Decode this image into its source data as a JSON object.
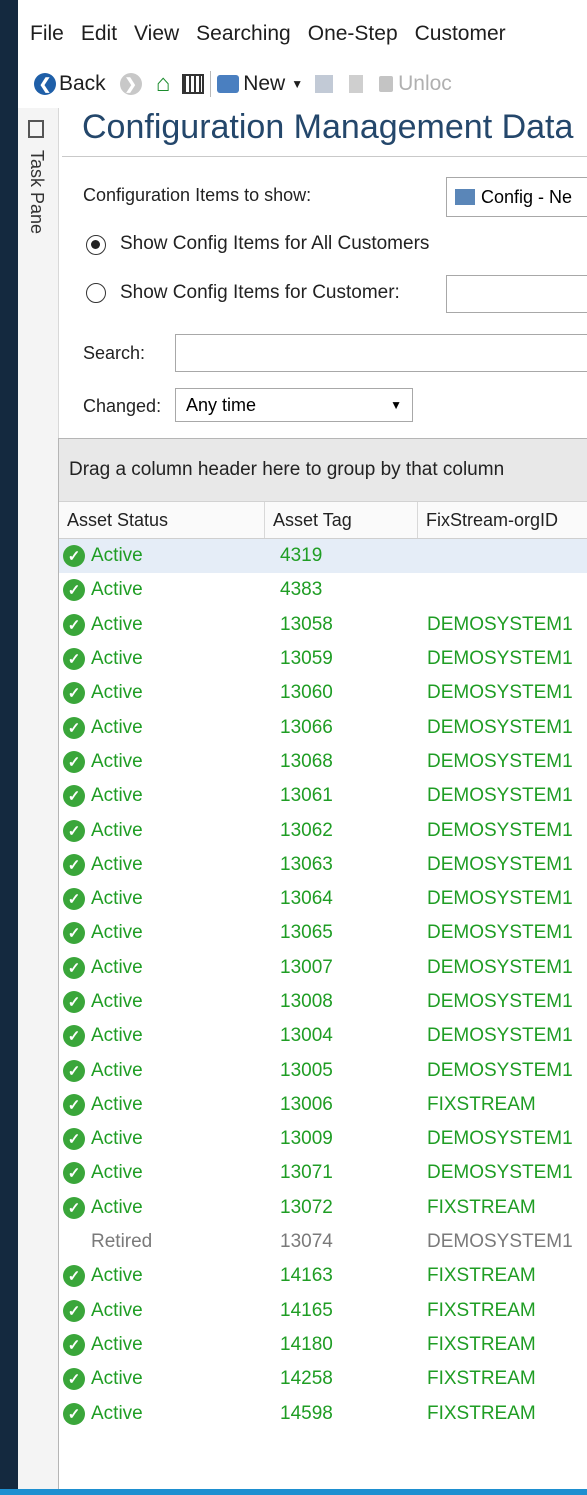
{
  "menu": [
    "File",
    "Edit",
    "View",
    "Searching",
    "One-Step",
    "Customer"
  ],
  "toolbar": {
    "back_label": "Back",
    "new_label": "New",
    "unlock_label": "Unloc"
  },
  "taskpane_label": "Task Pane",
  "title": "Configuration Management Data",
  "filters": {
    "items_to_show_label": "Configuration Items to show:",
    "items_to_show_value": "Config - Ne",
    "radio_all_label": "Show Config Items for All Customers",
    "radio_customer_label": "Show Config Items for Customer:",
    "search_label": "Search:",
    "search_value": "",
    "changed_label": "Changed:",
    "changed_value": "Any time"
  },
  "grid": {
    "group_panel_text": "Drag a column header here to group by that column",
    "columns": [
      "Asset Status",
      "Asset Tag",
      "FixStream-orgID"
    ],
    "rows": [
      {
        "status": "Active",
        "tag": "4319",
        "org": ""
      },
      {
        "status": "Active",
        "tag": "4383",
        "org": ""
      },
      {
        "status": "Active",
        "tag": "13058",
        "org": "DEMOSYSTEM1"
      },
      {
        "status": "Active",
        "tag": "13059",
        "org": "DEMOSYSTEM1"
      },
      {
        "status": "Active",
        "tag": "13060",
        "org": "DEMOSYSTEM1"
      },
      {
        "status": "Active",
        "tag": "13066",
        "org": "DEMOSYSTEM1"
      },
      {
        "status": "Active",
        "tag": "13068",
        "org": "DEMOSYSTEM1"
      },
      {
        "status": "Active",
        "tag": "13061",
        "org": "DEMOSYSTEM1"
      },
      {
        "status": "Active",
        "tag": "13062",
        "org": "DEMOSYSTEM1"
      },
      {
        "status": "Active",
        "tag": "13063",
        "org": "DEMOSYSTEM1"
      },
      {
        "status": "Active",
        "tag": "13064",
        "org": "DEMOSYSTEM1"
      },
      {
        "status": "Active",
        "tag": "13065",
        "org": "DEMOSYSTEM1"
      },
      {
        "status": "Active",
        "tag": "13007",
        "org": "DEMOSYSTEM1"
      },
      {
        "status": "Active",
        "tag": "13008",
        "org": "DEMOSYSTEM1"
      },
      {
        "status": "Active",
        "tag": "13004",
        "org": "DEMOSYSTEM1"
      },
      {
        "status": "Active",
        "tag": "13005",
        "org": "DEMOSYSTEM1"
      },
      {
        "status": "Active",
        "tag": "13006",
        "org": "FIXSTREAM"
      },
      {
        "status": "Active",
        "tag": "13009",
        "org": "DEMOSYSTEM1"
      },
      {
        "status": "Active",
        "tag": "13071",
        "org": "DEMOSYSTEM1"
      },
      {
        "status": "Active",
        "tag": "13072",
        "org": "FIXSTREAM"
      },
      {
        "status": "Retired",
        "tag": "13074",
        "org": "DEMOSYSTEM1"
      },
      {
        "status": "Active",
        "tag": "14163",
        "org": "FIXSTREAM"
      },
      {
        "status": "Active",
        "tag": "14165",
        "org": "FIXSTREAM"
      },
      {
        "status": "Active",
        "tag": "14180",
        "org": "FIXSTREAM"
      },
      {
        "status": "Active",
        "tag": "14258",
        "org": "FIXSTREAM"
      },
      {
        "status": "Active",
        "tag": "14598",
        "org": "FIXSTREAM"
      }
    ]
  },
  "colors": {
    "active_text": "#1f9d24",
    "retired_text": "#7a7a7a",
    "title": "#24476b",
    "check_icon": "#3aa63a",
    "selected_row": "#e5edf7",
    "desktop_background": "#14293f"
  }
}
